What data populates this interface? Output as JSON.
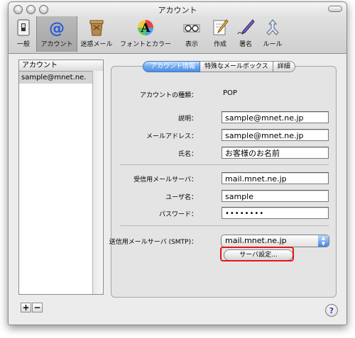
{
  "window": {
    "title": "アカウント"
  },
  "toolbar": [
    {
      "label": "一般",
      "icon": "switch-icon"
    },
    {
      "label": "アカウント",
      "icon": "at-sign-icon"
    },
    {
      "label": "迷惑メール",
      "icon": "junk-mail-icon"
    },
    {
      "label": "フォントとカラー",
      "icon": "font-color-icon"
    },
    {
      "label": "表示",
      "icon": "glasses-icon"
    },
    {
      "label": "作成",
      "icon": "compose-icon"
    },
    {
      "label": "署名",
      "icon": "signature-icon"
    },
    {
      "label": "ルール",
      "icon": "rules-icon"
    }
  ],
  "sidebar": {
    "header": "アカウント",
    "items": [
      {
        "label": "sample@mnet.ne."
      }
    ],
    "add_label": "+",
    "remove_label": "−"
  },
  "tabs": [
    {
      "label": "アカウント情報",
      "active": true
    },
    {
      "label": "特殊なメールボックス",
      "active": false
    },
    {
      "label": "詳細",
      "active": false
    }
  ],
  "form": {
    "account_type_label": "アカウントの種類：",
    "account_type_value": "POP",
    "description_label": "説明：",
    "description_value": "sample@mnet.ne.jp",
    "email_label": "メールアドレス：",
    "email_value": "sample@mnet.ne.jp",
    "name_label": "氏名：",
    "name_value": "お客様のお名前",
    "incoming_label": "受信用メールサーバ：",
    "incoming_value": "mail.mnet.ne.jp",
    "username_label": "ユーザ名：",
    "username_value": "sample",
    "password_label": "パスワード：",
    "password_value": "••••••••",
    "smtp_label": "送信用メールサーバ (SMTP)：",
    "smtp_value": "mail.mnet.ne.jp",
    "server_settings_button": "サーバ設定..."
  },
  "help": {
    "label": "?"
  },
  "colors": {
    "highlight": "#e41616",
    "active_tab": "#4c90e4"
  }
}
